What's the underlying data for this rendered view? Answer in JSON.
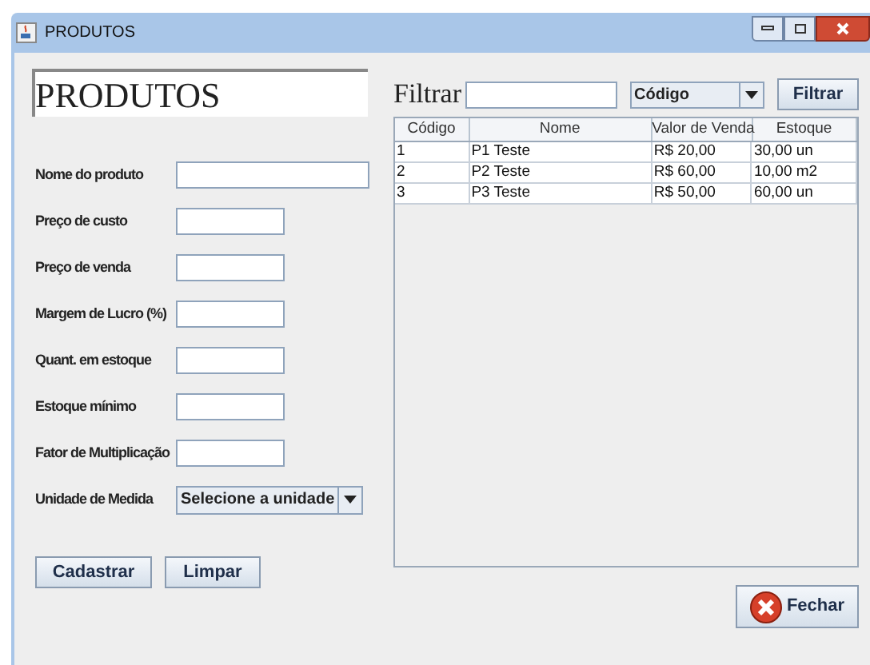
{
  "window": {
    "title": "PRODUTOS"
  },
  "heading": "PRODUTOS",
  "form": [
    {
      "label": "Nome do produto",
      "kind": "wide"
    },
    {
      "label": "Preço de custo",
      "kind": "field"
    },
    {
      "label": "Preço de venda",
      "kind": "field"
    },
    {
      "label": "Margem de Lucro (%)",
      "kind": "field"
    },
    {
      "label": "Quant. em estoque",
      "kind": "field"
    },
    {
      "label": "Estoque mínimo",
      "kind": "field"
    },
    {
      "label": "Fator de Multiplicação",
      "kind": "field"
    },
    {
      "label": "Unidade de Medida",
      "kind": "select",
      "value": "Selecione a unidade"
    }
  ],
  "form_buttons": [
    "Cadastrar",
    "Limpar"
  ],
  "filter": {
    "label": "Filtrar",
    "select": "Código",
    "button": "Filtrar"
  },
  "table": {
    "columns": [
      "Código",
      "Nome",
      "Valor de Venda",
      "Estoque"
    ],
    "rows": [
      [
        "1",
        "P1 Teste",
        "R$ 20,00",
        "30,00 un"
      ],
      [
        "2",
        "P2 Teste",
        "R$ 60,00",
        "10,00 m2"
      ],
      [
        "3",
        "P3 Teste",
        "R$ 50,00",
        "60,00 un"
      ]
    ]
  },
  "close_button": "Fechar"
}
